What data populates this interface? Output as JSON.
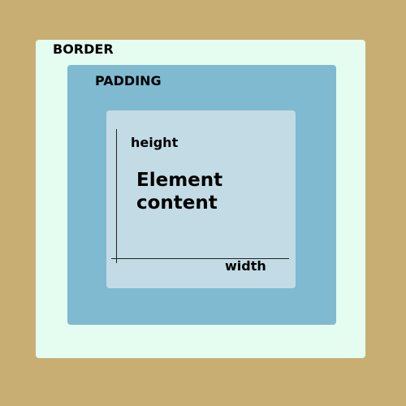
{
  "diagram": {
    "border_label": "BORDER",
    "padding_label": "PADDING",
    "content_label_line1": "Element",
    "content_label_line2": "content",
    "height_label": "height",
    "width_label": "width"
  },
  "colors": {
    "background": "#c9ae74",
    "border": "#e4fdf0",
    "padding": "#7fbad1",
    "content": "#c2dbe5",
    "axis": "#222222"
  }
}
